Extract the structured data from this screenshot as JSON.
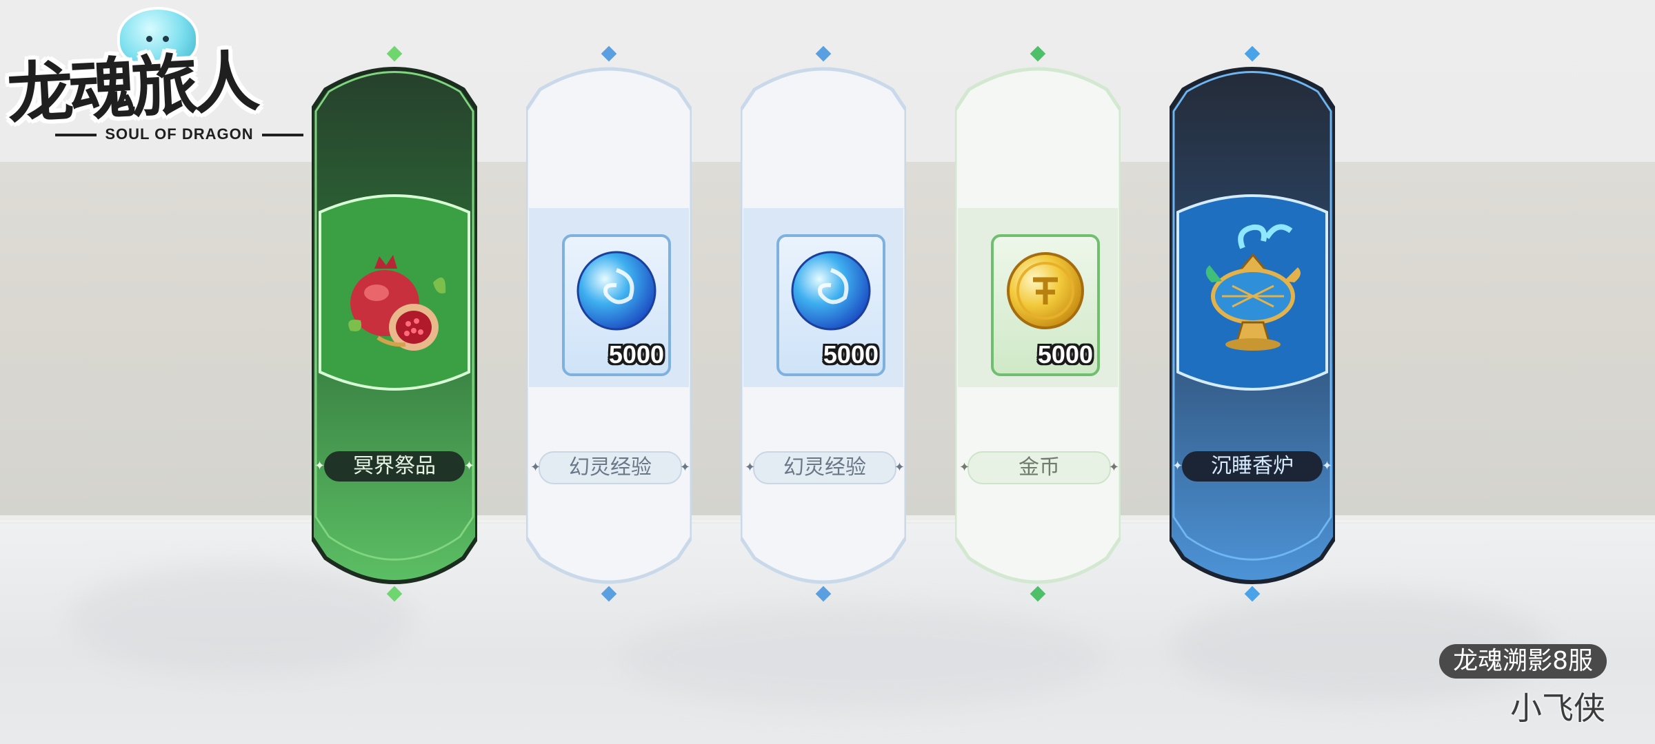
{
  "logo": {
    "title": "龙魂旅人",
    "subtitle": "SOUL OF DRAGON"
  },
  "cards": [
    {
      "name": "冥界祭品",
      "quantity": "",
      "icon": "pomegranate-icon",
      "theme": "green-rare",
      "accent": "#3fa34d"
    },
    {
      "name": "幻灵经验",
      "quantity": "5000",
      "icon": "blue-orb-icon",
      "theme": "white-blue",
      "accent": "#5aa0e0"
    },
    {
      "name": "幻灵经验",
      "quantity": "5000",
      "icon": "blue-orb-icon",
      "theme": "white-blue",
      "accent": "#5aa0e0"
    },
    {
      "name": "金币",
      "quantity": "5000",
      "icon": "gold-coin-icon",
      "theme": "white-green",
      "accent": "#6fbf6f"
    },
    {
      "name": "沉睡香炉",
      "quantity": "",
      "icon": "incense-burner-icon",
      "theme": "navy-rare",
      "accent": "#4aa3e8"
    }
  ],
  "footer": {
    "server": "龙魂溯影8服",
    "player": "小飞侠"
  }
}
